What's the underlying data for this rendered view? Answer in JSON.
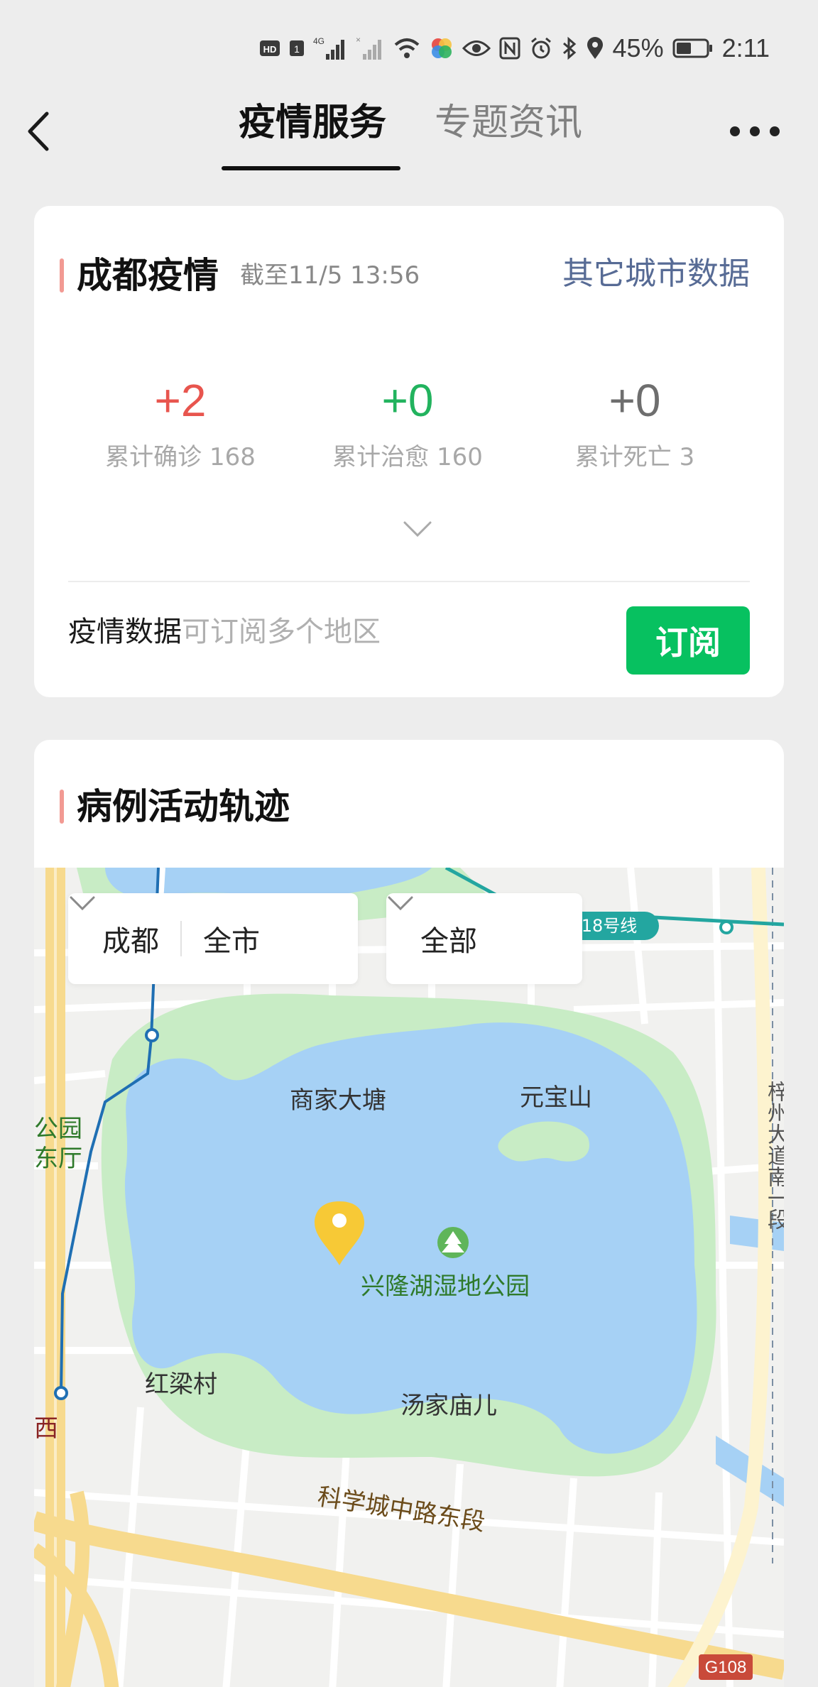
{
  "status_bar": {
    "battery_percent": "45%",
    "time": "2:11",
    "network": "4G",
    "sim_slot": "1"
  },
  "nav": {
    "tabs": [
      {
        "label": "疫情服务",
        "active": true
      },
      {
        "label": "专题资讯",
        "active": false
      }
    ]
  },
  "epidemic_card": {
    "title": "成都疫情",
    "updated": "截至11/5 13:56",
    "other_cities_link": "其它城市数据",
    "stats": [
      {
        "delta": "+2",
        "label": "累计确诊 168",
        "color": "#e8554e"
      },
      {
        "delta": "+0",
        "label": "累计治愈 160",
        "color": "#22b35e"
      },
      {
        "delta": "+0",
        "label": "累计死亡 3",
        "color": "#6e6e6e"
      }
    ],
    "subscribe_text": "疫情数据",
    "subscribe_hint": "可订阅多个地区",
    "subscribe_button": "订阅"
  },
  "trajectory_card": {
    "title": "病例活动轨迹",
    "city_select": "成都",
    "district_select": "全市",
    "category_select": "全部",
    "map_labels": {
      "place1": "商家大塘",
      "place2": "元宝山",
      "park": "兴隆湖湿地公园",
      "village1": "红梁村",
      "village2": "汤家庙儿",
      "road": "科学城中路东段",
      "metro_line": "18号线",
      "highway": "G108",
      "left_park_1": "公园",
      "left_park_2": "东厅",
      "left_red": "西",
      "right_vertical": "梓州大道南一段"
    }
  },
  "colors": {
    "accent_green": "#07c160",
    "link_blue": "#576b95",
    "title_accent": "#f29a93",
    "water": "#a6d1f5",
    "park": "#c8ecc5",
    "road_yellow": "#f7da8e"
  }
}
